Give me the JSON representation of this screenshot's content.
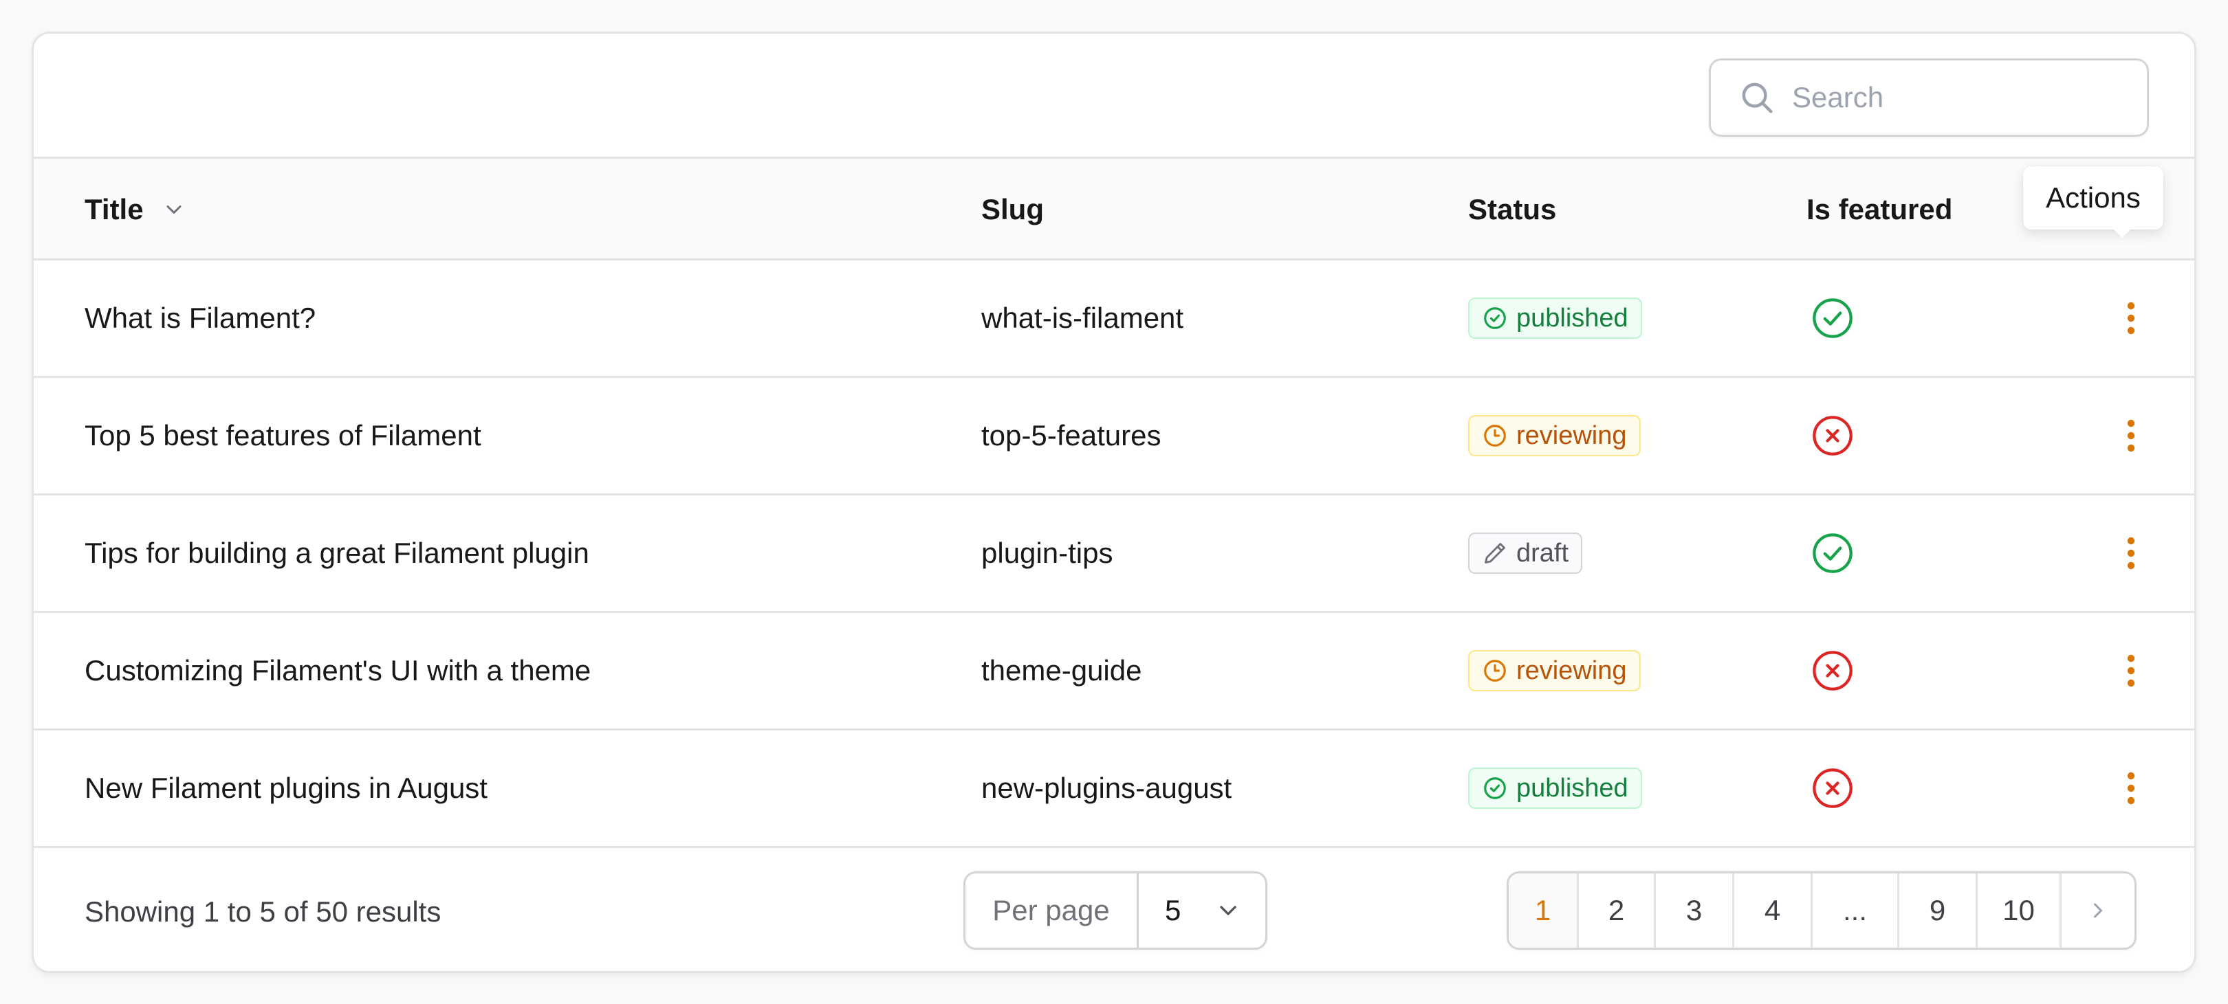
{
  "search": {
    "placeholder": "Search"
  },
  "columns": {
    "title": "Title",
    "slug": "Slug",
    "status": "Status",
    "is_featured": "Is featured"
  },
  "tooltip": "Actions",
  "rows": [
    {
      "title": "What is Filament?",
      "slug": "what-is-filament",
      "status": "published",
      "status_type": "success",
      "status_icon": "check-circle-icon",
      "featured": true
    },
    {
      "title": "Top 5 best features of Filament",
      "slug": "top-5-features",
      "status": "reviewing",
      "status_type": "warning",
      "status_icon": "clock-icon",
      "featured": false
    },
    {
      "title": "Tips for building a great Filament plugin",
      "slug": "plugin-tips",
      "status": "draft",
      "status_type": "gray",
      "status_icon": "pencil-icon",
      "featured": true
    },
    {
      "title": "Customizing Filament's UI with a theme",
      "slug": "theme-guide",
      "status": "reviewing",
      "status_type": "warning",
      "status_icon": "clock-icon",
      "featured": false
    },
    {
      "title": "New Filament plugins in August",
      "slug": "new-plugins-august",
      "status": "published",
      "status_type": "success",
      "status_icon": "check-circle-icon",
      "featured": false
    }
  ],
  "footer": {
    "results": "Showing 1 to 5 of 50 results",
    "per_page_label": "Per page",
    "per_page_value": "5",
    "pages": [
      "1",
      "2",
      "3",
      "4",
      "...",
      "9",
      "10"
    ],
    "current_page": "1"
  },
  "colors": {
    "accent": "#d97706",
    "success": "#16a34a",
    "danger": "#dc2626",
    "border": "#e4e4e7"
  }
}
